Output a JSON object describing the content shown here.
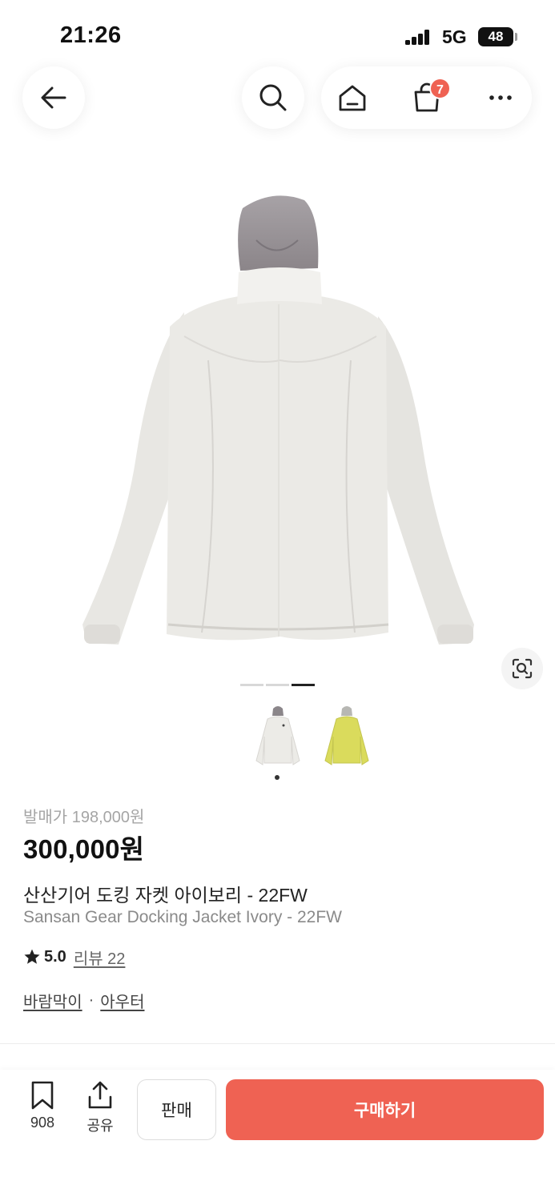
{
  "status_bar": {
    "time": "21:26",
    "network": "5G",
    "battery": "48"
  },
  "nav": {
    "icons": [
      "back-arrow-icon",
      "search-icon",
      "home-icon",
      "shopping-bag-icon",
      "more-icon"
    ],
    "cart_count": "7"
  },
  "gallery": {
    "image_count": 3,
    "active_index": 2,
    "variants": [
      {
        "color_name": "ivory",
        "color": "#eceae6"
      },
      {
        "color_name": "lime",
        "color": "#dadb5c"
      }
    ],
    "lens_icon": "lens-search-icon"
  },
  "product": {
    "release_price": "발매가 198,000원",
    "price": "300,000원",
    "name_ko": "산산기어 도킹 자켓 아이보리 - 22FW",
    "name_en": "Sansan Gear Docking Jacket Ivory - 22FW",
    "rating": "5.0",
    "review_label": "리뷰 22",
    "categories": [
      "바람막이",
      "아우터"
    ],
    "category_separator": "·"
  },
  "bottom_bar": {
    "bookmark_count": "908",
    "share_label": "공유",
    "sell_label": "판매",
    "buy_label": "구매하기"
  },
  "colors": {
    "accent": "#ef6253"
  }
}
